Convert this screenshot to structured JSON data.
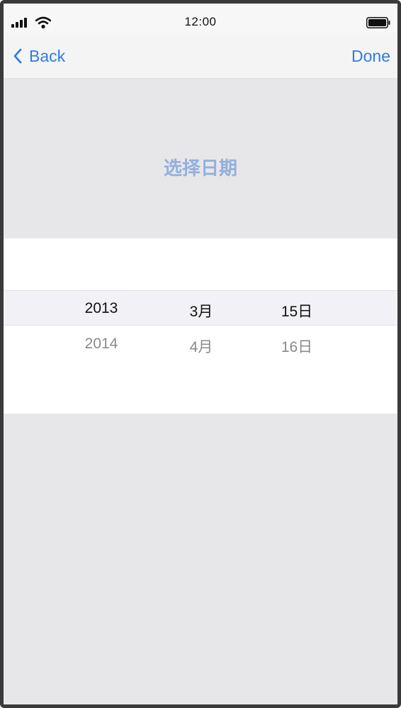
{
  "status_bar": {
    "time": "12:00",
    "signal_icon": "cellular-signal-icon",
    "wifi_icon": "wifi-icon",
    "battery_icon": "battery-icon"
  },
  "nav": {
    "back_label": "Back",
    "back_icon": "chevron-left-icon",
    "done_label": "Done",
    "accent_color": "#2f7de1"
  },
  "header": {
    "title": "选择日期",
    "title_color": "#93b0dc"
  },
  "date_picker": {
    "columns": [
      {
        "name": "year",
        "selected": "2013",
        "next": "2014"
      },
      {
        "name": "month",
        "selected": "3月",
        "next": "4月"
      },
      {
        "name": "day",
        "selected": "15日",
        "next": "16日"
      }
    ]
  }
}
